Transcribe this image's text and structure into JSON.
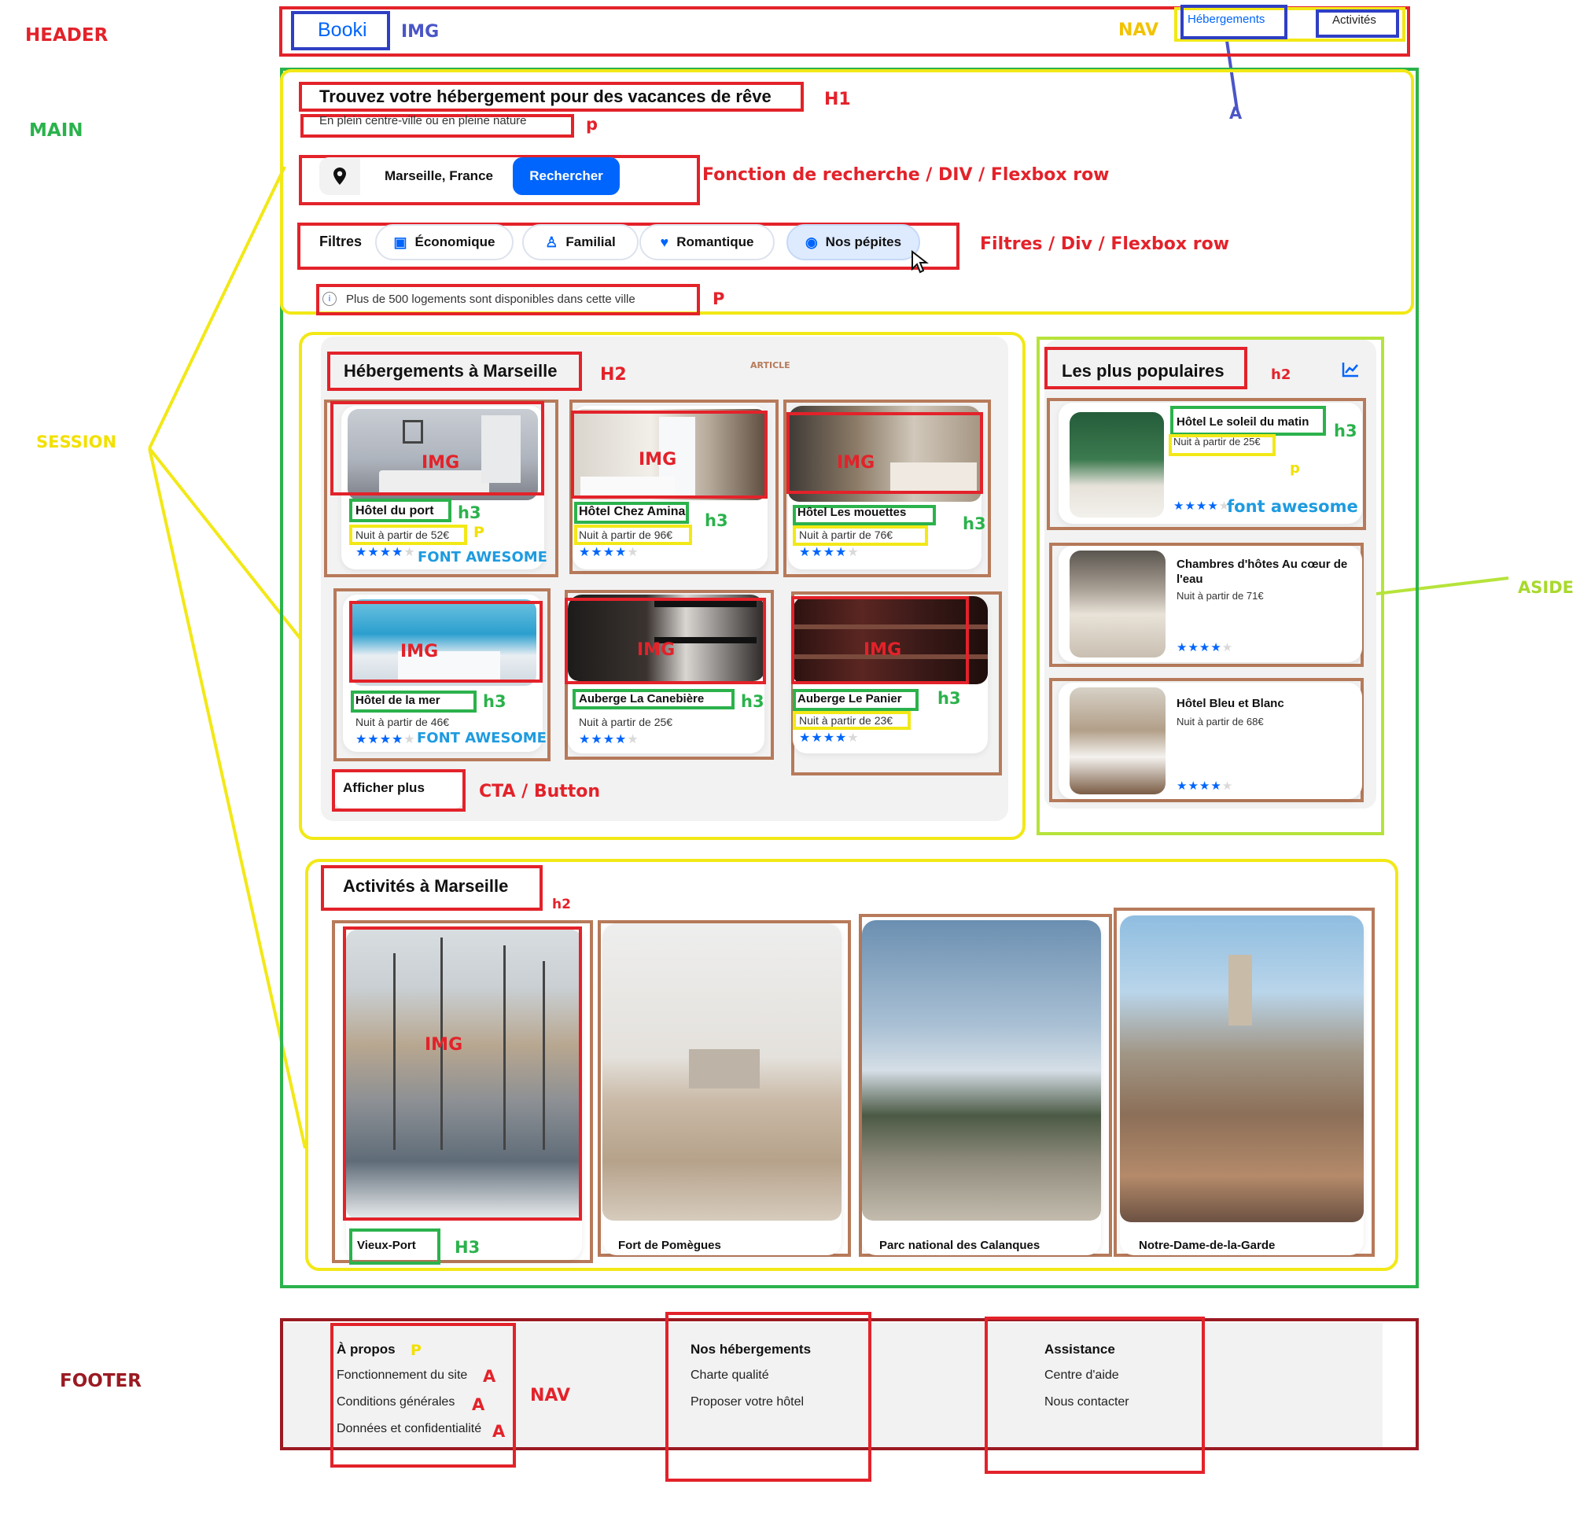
{
  "annotations": {
    "header": "HEADER",
    "main": "MAIN",
    "session": "SESSION",
    "aside": "ASIDE",
    "footer": "FOOTER",
    "img": "IMG",
    "nav": "NAV",
    "a": "A",
    "h1": "H1",
    "h2_upper": "H2",
    "h2": "h2",
    "h3": "h3",
    "h3_upper": "H3",
    "p": "p",
    "p_upper": "P",
    "article": "ARTICLE",
    "search": "Fonction de recherche / DIV  / Flexbox row",
    "filters": "Filtres / Div  / Flexbox row",
    "cta": "CTA / Button",
    "font_awesome_upper": "FONT AWESOME",
    "font_awesome": "font awesome"
  },
  "header": {
    "logo": "Booki",
    "nav": [
      "Hébergements",
      "Activités"
    ]
  },
  "hero": {
    "title": "Trouvez votre hébergement pour des vacances de rêve",
    "subtitle": "En plein centre-ville ou en pleine nature",
    "search_value": "Marseille, France",
    "search_button": "Rechercher",
    "filters_label": "Filtres",
    "filters": [
      "Économique",
      "Familial",
      "Romantique",
      "Nos pépites"
    ],
    "info": "Plus de 500 logements sont disponibles dans cette ville"
  },
  "lodgings": {
    "title": "Hébergements à Marseille",
    "items": [
      {
        "name": "Hôtel du port",
        "price": "Nuit à partir de 52€",
        "stars": 4
      },
      {
        "name": "Hôtel Chez Amina",
        "price": "Nuit à partir de 96€",
        "stars": 4
      },
      {
        "name": "Hôtel Les mouettes",
        "price": "Nuit à partir de 76€",
        "stars": 4
      },
      {
        "name": "Hôtel de la mer",
        "price": "Nuit à partir de 46€",
        "stars": 4
      },
      {
        "name": "Auberge La Canebière",
        "price": "Nuit à partir de 25€",
        "stars": 4
      },
      {
        "name": "Auberge Le Panier",
        "price": "Nuit à partir de 23€",
        "stars": 4
      }
    ],
    "more_button": "Afficher plus"
  },
  "popular": {
    "title": "Les plus populaires",
    "items": [
      {
        "name": "Hôtel Le soleil du matin",
        "price": "Nuit à partir de 25€",
        "stars": 4
      },
      {
        "name": "Chambres d'hôtes Au cœur de l'eau",
        "price": "Nuit à partir de 71€",
        "stars": 4
      },
      {
        "name": "Hôtel Bleu et Blanc",
        "price": "Nuit à partir de 68€",
        "stars": 4
      }
    ]
  },
  "activities": {
    "title": "Activités à Marseille",
    "items": [
      "Vieux-Port",
      "Fort de Pomègues",
      "Parc national des Calanques",
      "Notre-Dame-de-la-Garde"
    ]
  },
  "footer": {
    "columns": [
      {
        "title": "À propos",
        "links": [
          "Fonctionnement du site",
          "Conditions générales",
          "Données et confidentialité"
        ]
      },
      {
        "title": "Nos hébergements",
        "links": [
          "Charte qualité",
          "Proposer votre hôtel"
        ]
      },
      {
        "title": "Assistance",
        "links": [
          "Centre d'aide",
          "Nous contacter"
        ]
      }
    ]
  },
  "colors": {
    "brand": "#0065fc",
    "annotation_red": "#e3222a",
    "annotation_green": "#2bb24c",
    "annotation_yellow": "#f2e816",
    "annotation_blue": "#2f3fc4",
    "annotation_brown": "#b77a5a"
  }
}
